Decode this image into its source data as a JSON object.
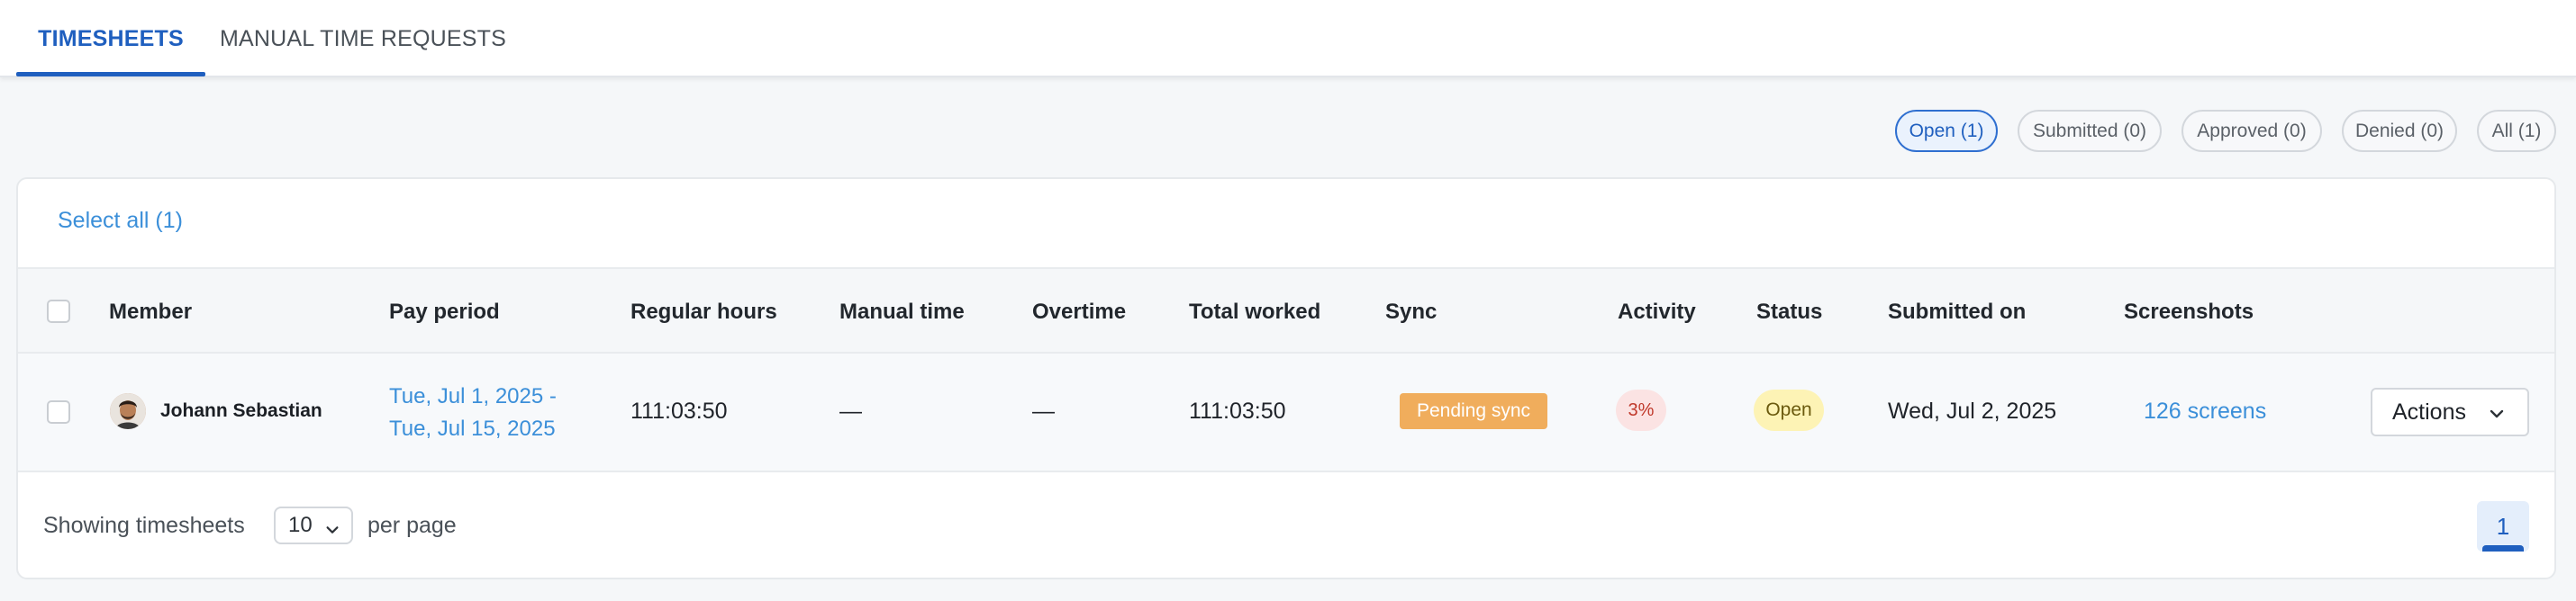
{
  "tabs": [
    {
      "label": "TIMESHEETS"
    },
    {
      "label": "MANUAL TIME REQUESTS"
    }
  ],
  "filters": [
    {
      "label": "Open (1)"
    },
    {
      "label": "Submitted (0)"
    },
    {
      "label": "Approved (0)"
    },
    {
      "label": "Denied (0)"
    },
    {
      "label": "All (1)"
    }
  ],
  "select_all": "Select all (1)",
  "columns": {
    "member": "Member",
    "pay_period": "Pay period",
    "regular_hours": "Regular hours",
    "manual_time": "Manual time",
    "overtime": "Overtime",
    "total_worked": "Total worked",
    "sync": "Sync",
    "activity": "Activity",
    "status": "Status",
    "submitted_on": "Submitted on",
    "screenshots": "Screenshots"
  },
  "rows": [
    {
      "member": "Johann Sebastian",
      "pay_period_start": "Tue, Jul 1, 2025 -",
      "pay_period_end": "Tue, Jul 15, 2025",
      "regular_hours": "111:03:50",
      "manual_time": "—",
      "overtime": "—",
      "total_worked": "111:03:50",
      "sync": "Pending sync",
      "activity": "3%",
      "status": "Open",
      "submitted_on": "Wed, Jul 2, 2025",
      "screenshots": "126 screens",
      "actions": "Actions"
    }
  ],
  "footer": {
    "showing": "Showing timesheets",
    "per_page_value": "10",
    "per_page_suffix": "per page",
    "current_page": "1"
  },
  "colors": {
    "accent": "#1f5fbf",
    "link": "#3b8fd9",
    "sync_badge": "#f0ad5c",
    "activity_badge_bg": "#fbe3e3",
    "status_badge_bg": "#fdf3b5"
  },
  "icons": {
    "actions_chevron": "chevron-down-icon",
    "per_page_chevron": "chevron-down-icon",
    "member_avatar": "avatar"
  }
}
